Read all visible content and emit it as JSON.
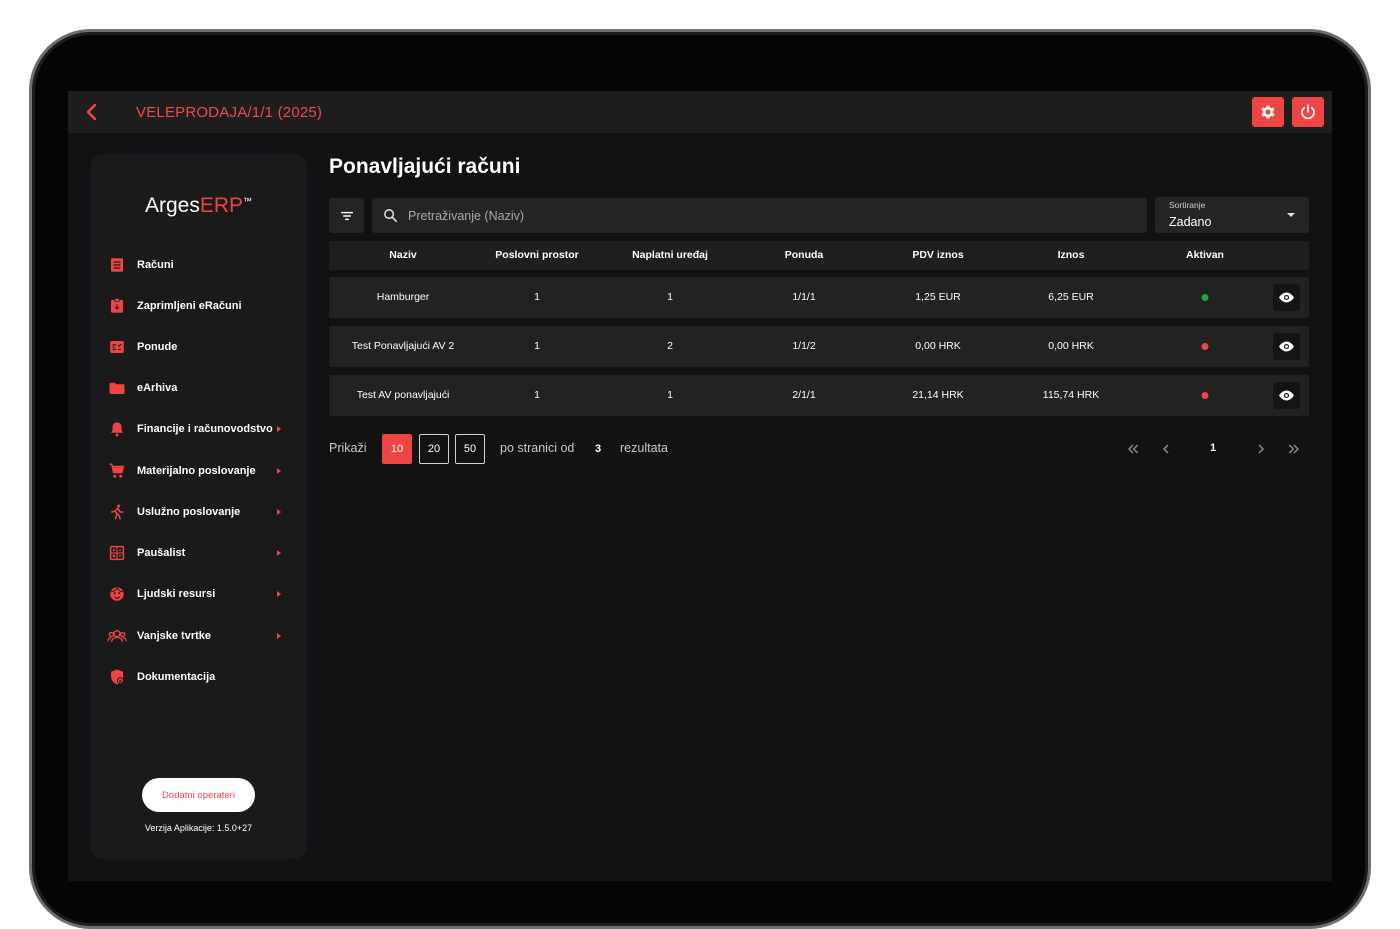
{
  "topbar": {
    "title": "VELEPRODAJA/1/1 (2025)",
    "back_icon": "chevron-left-icon",
    "settings_icon": "gear-icon",
    "power_icon": "power-icon"
  },
  "colors": {
    "accent": "#ef4444",
    "active_dot": "#22a83a",
    "inactive_dot": "#ef4444",
    "background": "#121212",
    "surface": "#222222"
  },
  "sidebar": {
    "logo_main": "Arges",
    "logo_accent": "ERP",
    "logo_tm": "™",
    "items": [
      {
        "label": "Računi",
        "icon": "receipt-icon",
        "has_submenu": false
      },
      {
        "label": "Zaprimljeni eRačuni",
        "icon": "clipboard-icon",
        "has_submenu": false
      },
      {
        "label": "Ponude",
        "icon": "offer-list-icon",
        "has_submenu": false
      },
      {
        "label": "eArhiva",
        "icon": "folder-icon",
        "has_submenu": false
      },
      {
        "label": "Financije i računovodstvo",
        "icon": "bell-icon",
        "has_submenu": true
      },
      {
        "label": "Materijalno poslovanje",
        "icon": "cart-icon",
        "has_submenu": true
      },
      {
        "label": "Uslužno poslovanje",
        "icon": "running-icon",
        "has_submenu": true
      },
      {
        "label": "Paušalist",
        "icon": "calculator-icon",
        "has_submenu": true
      },
      {
        "label": "Ljudski resursi",
        "icon": "face-icon",
        "has_submenu": true
      },
      {
        "label": "Vanjske tvrtke",
        "icon": "group-icon",
        "has_submenu": true
      },
      {
        "label": "Dokumentacija",
        "icon": "shield-lock-icon",
        "has_submenu": false
      }
    ],
    "extra_operators_button": "Dodatni operateri",
    "version": "Verzija Aplikacije: 1.5.0+27"
  },
  "main": {
    "title": "Ponavljajući računi",
    "search_placeholder": "Pretraživanje (Naziv)",
    "search_value": "",
    "sort": {
      "label": "Sortiranje",
      "value": "Zadano"
    },
    "table": {
      "columns": [
        "Naziv",
        "Poslovni prostor",
        "Naplatni uređaj",
        "Ponuda",
        "PDV iznos",
        "Iznos",
        "Aktivan"
      ],
      "rows": [
        {
          "naziv": "Hamburger",
          "prostor": "1",
          "uredaj": "1",
          "ponuda": "1/1/1",
          "pdv": "1,25 EUR",
          "iznos": "6,25 EUR",
          "aktivan": true
        },
        {
          "naziv": "Test Ponavljajući AV 2",
          "prostor": "1",
          "uredaj": "2",
          "ponuda": "1/1/2",
          "pdv": "0,00 HRK",
          "iznos": "0,00 HRK",
          "aktivan": false
        },
        {
          "naziv": "Test AV ponavljajući",
          "prostor": "1",
          "uredaj": "1",
          "ponuda": "2/1/1",
          "pdv": "21,14 HRK",
          "iznos": "115,74 HRK",
          "aktivan": false
        }
      ]
    },
    "pagination": {
      "show_label": "Prikaži",
      "page_sizes": [
        "10",
        "20",
        "50"
      ],
      "selected_size": "10",
      "per_page_label": "po stranici od",
      "total": "3",
      "results_label": "rezultata",
      "current_page": "1"
    }
  }
}
